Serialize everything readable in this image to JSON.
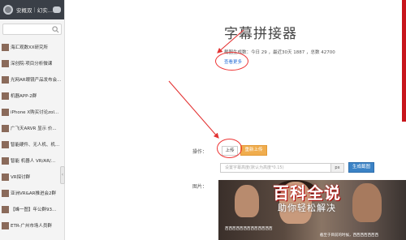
{
  "sidebar": {
    "header": {
      "title": "安概双",
      "subtitle": "幻实..."
    },
    "items": [
      {
        "label": "海汇观数XX研究所"
      },
      {
        "label": "深创院·项目分析微课"
      },
      {
        "label": "光网AR眼镜产品发布会..."
      },
      {
        "label": "机器APP-2群"
      },
      {
        "label": "iPhone X购买讨论zol..."
      },
      {
        "label": "广飞天ARVR 显示 价..."
      },
      {
        "label": "智能硬件、无人机、机..."
      },
      {
        "label": "智能 机器人 VR/AR/..."
      },
      {
        "label": "VR探讨群"
      },
      {
        "label": "亚洲VR&AR推进会2群"
      },
      {
        "label": "【峰一图】年公群93..."
      },
      {
        "label": "ETR-广州市场人员群"
      }
    ]
  },
  "main": {
    "title": "字幕拼接器",
    "stats": "截图生成数：今日 29 ，最近30天 1887 ，总数 42700",
    "details_link": "查看更多",
    "operation_label": "操作：",
    "upload_label": "上传",
    "reupload_label": "重新上传",
    "height_placeholder": "设置字幕高度(默认为高度*0.15)",
    "px_label": "px",
    "generate_label": "生成截图",
    "image_label": "图片：",
    "subtitle_line_1": "西西西西西西西西西西西西西",
    "subtitle_line_2": "截至于目前的时候，西西西西西西西"
  },
  "watermark": {
    "top": "百科全说",
    "bottom": "助你轻松解决"
  },
  "colors": {
    "annotation_red": "#e33333",
    "orange_button": "#f0ad4e",
    "blue_button": "#3b83c6",
    "sidebar_header": "#3a3f47"
  }
}
